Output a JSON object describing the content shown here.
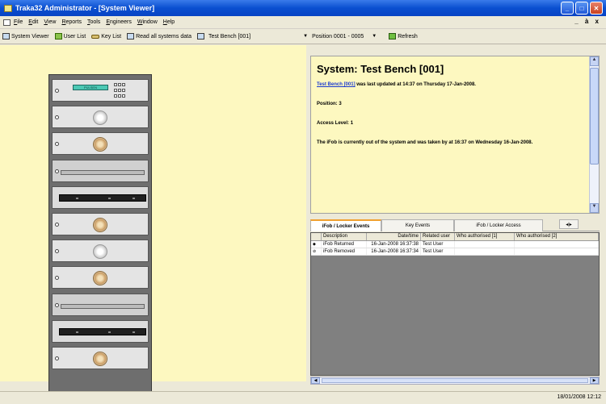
{
  "window": {
    "title": "Traka32 Administrator - [System Viewer]"
  },
  "menu": {
    "items": [
      "File",
      "Edit",
      "View",
      "Reports",
      "Tools",
      "Engineers",
      "Window",
      "Help"
    ],
    "mdi_controls": "_ à x"
  },
  "toolbar": {
    "system_viewer": "System Viewer",
    "user_list": "User List",
    "key_list": "Key List",
    "read_all": "Read all systems data",
    "system_name": "Test Bench [001]",
    "position_combo": "Position 0001 - 0005",
    "refresh": "Refresh"
  },
  "rack": {
    "display_text": "PULSEN"
  },
  "info": {
    "title": "System: Test Bench [001]",
    "link": "Test Bench [001]",
    "updated_text": "was last updated at 14:37 on Thursday 17-Jan-2008.",
    "position": "Position: 3",
    "access_level": "Access Level: 1",
    "status": "The iFob is currently out of the system and was taken by at 16:37 on Wednesday 16-Jan-2008."
  },
  "tabs": [
    "iFob / Locker Events",
    "Key Events",
    "iFob / Locker Access"
  ],
  "grid": {
    "headers": [
      "",
      "Description",
      "Date/time",
      "Related user",
      "Who authorised [1]",
      "Who authorised [2]"
    ],
    "rows": [
      {
        "icon": "◆",
        "description": "iFob Returned",
        "datetime": "16-Jan-2008  16:37:38",
        "user": "Test User",
        "auth1": "",
        "auth2": ""
      },
      {
        "icon": "⊘",
        "description": "iFob Removed",
        "datetime": "16-Jan-2008  16:37:34",
        "user": "Test User",
        "auth1": "",
        "auth2": ""
      }
    ]
  },
  "status": {
    "datetime": "18/01/2008   12:12"
  }
}
